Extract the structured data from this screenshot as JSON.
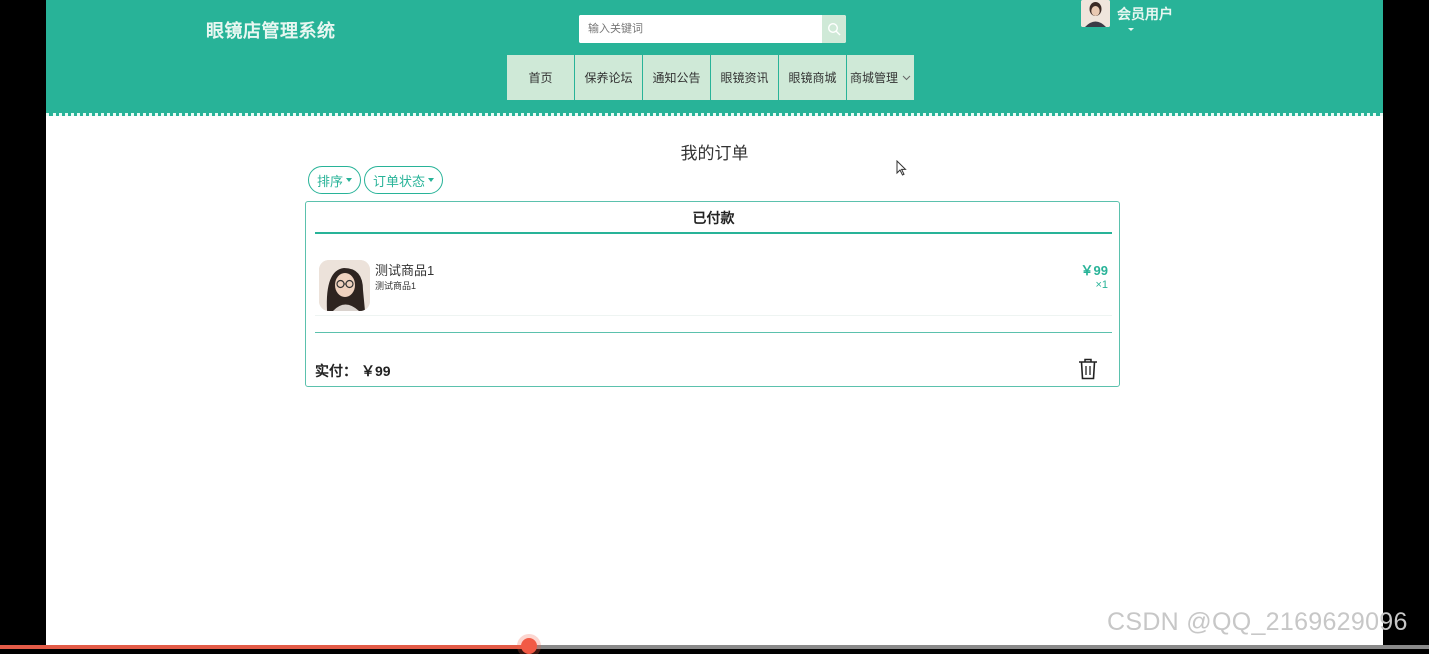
{
  "header": {
    "brand": "眼镜店管理系统",
    "search": {
      "placeholder": "输入关键词"
    },
    "user": {
      "name": "会员用户"
    },
    "nav": [
      {
        "label": "首页"
      },
      {
        "label": "保养论坛"
      },
      {
        "label": "通知公告"
      },
      {
        "label": "眼镜资讯"
      },
      {
        "label": "眼镜商城"
      },
      {
        "label": "商城管理",
        "dropdown": true
      }
    ]
  },
  "page": {
    "title": "我的订单",
    "filters": [
      {
        "label": "排序"
      },
      {
        "label": "订单状态"
      }
    ]
  },
  "order": {
    "status": "已付款",
    "item": {
      "name": "测试商品1",
      "subtitle": "测试商品1",
      "price": "￥99",
      "quantity": "×1"
    },
    "total_label": "实付：",
    "total_value": "￥99"
  },
  "player": {
    "progress": 0.37
  },
  "watermark": "CSDN @QQ_2169629096",
  "colors": {
    "primary": "#28b398",
    "nav_bg": "#cfe9d7",
    "progress": "#e35b47"
  }
}
